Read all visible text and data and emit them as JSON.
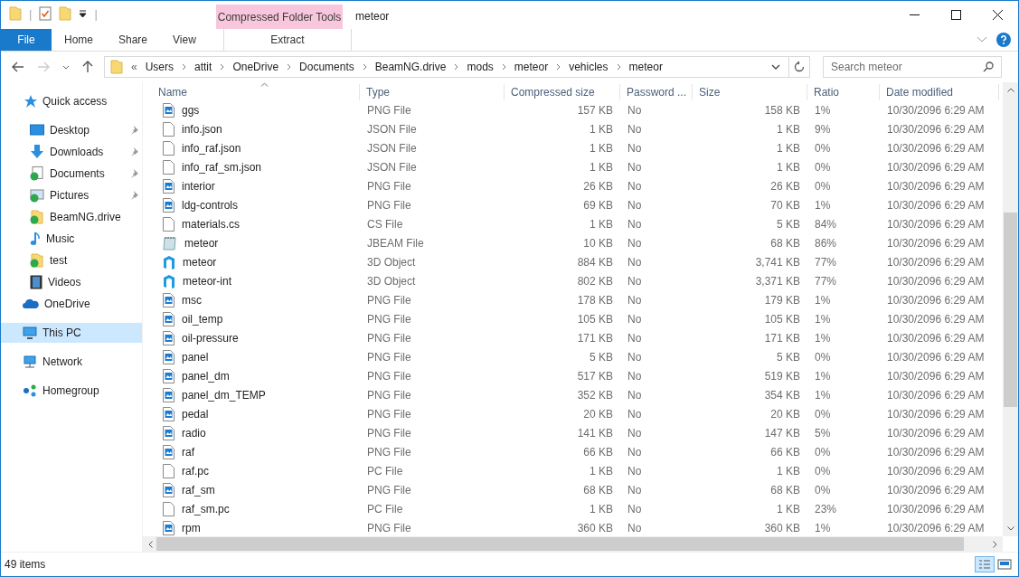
{
  "window": {
    "title": "meteor"
  },
  "quick_access_toolbar": {
    "separator": "|"
  },
  "context_tab_group": {
    "label": "Compressed Folder Tools"
  },
  "ribbon_tabs": [
    {
      "label": "File",
      "kind": "file",
      "selected": false
    },
    {
      "label": "Home",
      "kind": "tab",
      "selected": false
    },
    {
      "label": "Share",
      "kind": "tab",
      "selected": false
    },
    {
      "label": "View",
      "kind": "tab",
      "selected": false
    },
    {
      "label": "Extract",
      "kind": "context",
      "selected": false
    }
  ],
  "address_bar": {
    "overflow": "«",
    "crumbs": [
      "Users",
      "attit",
      "OneDrive",
      "Documents",
      "BeamNG.drive",
      "mods",
      "meteor",
      "vehicles",
      "meteor"
    ]
  },
  "search": {
    "placeholder": "Search meteor"
  },
  "sidebar": {
    "items": [
      {
        "label": "Quick access",
        "kind": "quick",
        "selected": false,
        "children": [
          {
            "label": "Desktop",
            "kind": "desktop",
            "pinned": true,
            "selected": false
          },
          {
            "label": "Downloads",
            "kind": "downloads",
            "pinned": true,
            "selected": false
          },
          {
            "label": "Documents",
            "kind": "documents",
            "pinned": true,
            "selected": false
          },
          {
            "label": "Pictures",
            "kind": "pictures",
            "pinned": true,
            "selected": false
          },
          {
            "label": "BeamNG.drive",
            "kind": "folder",
            "pinned": false,
            "selected": false
          },
          {
            "label": "Music",
            "kind": "music",
            "pinned": false,
            "selected": false
          },
          {
            "label": "test",
            "kind": "folder",
            "pinned": false,
            "selected": false
          },
          {
            "label": "Videos",
            "kind": "videos",
            "pinned": false,
            "selected": false
          }
        ]
      },
      {
        "label": "OneDrive",
        "kind": "cloud",
        "selected": false
      },
      {
        "label": "This PC",
        "kind": "pc",
        "selected": true
      },
      {
        "label": "Network",
        "kind": "network",
        "selected": false
      },
      {
        "label": "Homegroup",
        "kind": "homegroup",
        "selected": false
      }
    ]
  },
  "table": {
    "columns": [
      "Name",
      "Type",
      "Compressed size",
      "Password ...",
      "Size",
      "Ratio",
      "Date modified"
    ],
    "rows": [
      {
        "kind": "image",
        "cells": [
          "ggs",
          "PNG File",
          "157 KB",
          "No",
          "158 KB",
          "1%",
          "10/30/2096 6:29 AM"
        ]
      },
      {
        "kind": "text",
        "cells": [
          "info.json",
          "JSON File",
          "1 KB",
          "No",
          "1 KB",
          "9%",
          "10/30/2096 6:29 AM"
        ]
      },
      {
        "kind": "text",
        "cells": [
          "info_raf.json",
          "JSON File",
          "1 KB",
          "No",
          "1 KB",
          "0%",
          "10/30/2096 6:29 AM"
        ]
      },
      {
        "kind": "text",
        "cells": [
          "info_raf_sm.json",
          "JSON File",
          "1 KB",
          "No",
          "1 KB",
          "0%",
          "10/30/2096 6:29 AM"
        ]
      },
      {
        "kind": "image",
        "cells": [
          "interior",
          "PNG File",
          "26 KB",
          "No",
          "26 KB",
          "0%",
          "10/30/2096 6:29 AM"
        ]
      },
      {
        "kind": "image",
        "cells": [
          "ldg-controls",
          "PNG File",
          "69 KB",
          "No",
          "70 KB",
          "1%",
          "10/30/2096 6:29 AM"
        ]
      },
      {
        "kind": "text",
        "cells": [
          "materials.cs",
          "CS File",
          "1 KB",
          "No",
          "5 KB",
          "84%",
          "10/30/2096 6:29 AM"
        ]
      },
      {
        "kind": "notepad",
        "cells": [
          "meteor",
          "JBEAM File",
          "10 KB",
          "No",
          "68 KB",
          "86%",
          "10/30/2096 6:29 AM"
        ]
      },
      {
        "kind": "object",
        "cells": [
          "meteor",
          "3D Object",
          "884 KB",
          "No",
          "3,741 KB",
          "77%",
          "10/30/2096 6:29 AM"
        ]
      },
      {
        "kind": "object",
        "cells": [
          "meteor-int",
          "3D Object",
          "802 KB",
          "No",
          "3,371 KB",
          "77%",
          "10/30/2096 6:29 AM"
        ]
      },
      {
        "kind": "image",
        "cells": [
          "msc",
          "PNG File",
          "178 KB",
          "No",
          "179 KB",
          "1%",
          "10/30/2096 6:29 AM"
        ]
      },
      {
        "kind": "image",
        "cells": [
          "oil_temp",
          "PNG File",
          "105 KB",
          "No",
          "105 KB",
          "1%",
          "10/30/2096 6:29 AM"
        ]
      },
      {
        "kind": "image",
        "cells": [
          "oil-pressure",
          "PNG File",
          "171 KB",
          "No",
          "171 KB",
          "1%",
          "10/30/2096 6:29 AM"
        ]
      },
      {
        "kind": "image",
        "cells": [
          "panel",
          "PNG File",
          "5 KB",
          "No",
          "5 KB",
          "0%",
          "10/30/2096 6:29 AM"
        ]
      },
      {
        "kind": "image",
        "cells": [
          "panel_dm",
          "PNG File",
          "517 KB",
          "No",
          "519 KB",
          "1%",
          "10/30/2096 6:29 AM"
        ]
      },
      {
        "kind": "image",
        "cells": [
          "panel_dm_TEMP",
          "PNG File",
          "352 KB",
          "No",
          "354 KB",
          "1%",
          "10/30/2096 6:29 AM"
        ]
      },
      {
        "kind": "image",
        "cells": [
          "pedal",
          "PNG File",
          "20 KB",
          "No",
          "20 KB",
          "0%",
          "10/30/2096 6:29 AM"
        ]
      },
      {
        "kind": "image",
        "cells": [
          "radio",
          "PNG File",
          "141 KB",
          "No",
          "147 KB",
          "5%",
          "10/30/2096 6:29 AM"
        ]
      },
      {
        "kind": "image",
        "cells": [
          "raf",
          "PNG File",
          "66 KB",
          "No",
          "66 KB",
          "0%",
          "10/30/2096 6:29 AM"
        ]
      },
      {
        "kind": "text",
        "cells": [
          "raf.pc",
          "PC File",
          "1 KB",
          "No",
          "1 KB",
          "0%",
          "10/30/2096 6:29 AM"
        ]
      },
      {
        "kind": "image",
        "cells": [
          "raf_sm",
          "PNG File",
          "68 KB",
          "No",
          "68 KB",
          "0%",
          "10/30/2096 6:29 AM"
        ]
      },
      {
        "kind": "text",
        "cells": [
          "raf_sm.pc",
          "PC File",
          "1 KB",
          "No",
          "1 KB",
          "23%",
          "10/30/2096 6:29 AM"
        ]
      },
      {
        "kind": "image",
        "cells": [
          "rpm",
          "PNG File",
          "360 KB",
          "No",
          "360 KB",
          "1%",
          "10/30/2096 6:29 AM"
        ]
      }
    ]
  },
  "status_bar": {
    "item_count": "49 items"
  }
}
